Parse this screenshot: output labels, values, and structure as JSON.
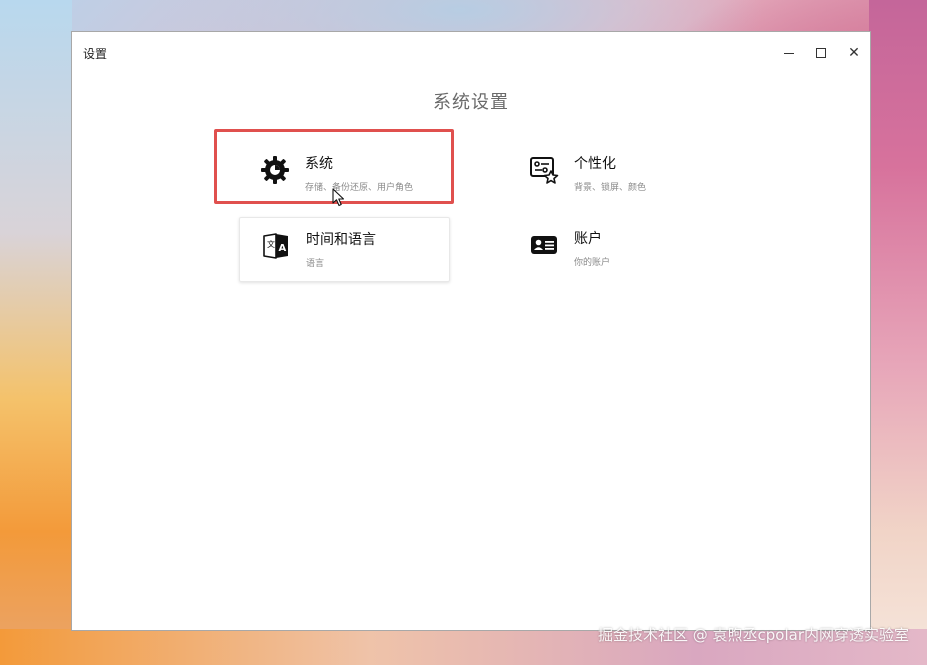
{
  "window": {
    "title": "设置"
  },
  "page": {
    "heading": "系统设置"
  },
  "cards": [
    {
      "title": "系统",
      "subtitle": "存储、备份还原、用户角色",
      "icon": "gear-icon"
    },
    {
      "title": "个性化",
      "subtitle": "背景、锁屏、颜色",
      "icon": "personalize-icon"
    },
    {
      "title": "时间和语言",
      "subtitle": "语言",
      "icon": "language-icon"
    },
    {
      "title": "账户",
      "subtitle": "你的账户",
      "icon": "account-card-icon"
    }
  ],
  "highlight_color": "#e0504e",
  "watermark": "掘金技术社区 @ 袁煦丞cpolar内网穿透实验室"
}
